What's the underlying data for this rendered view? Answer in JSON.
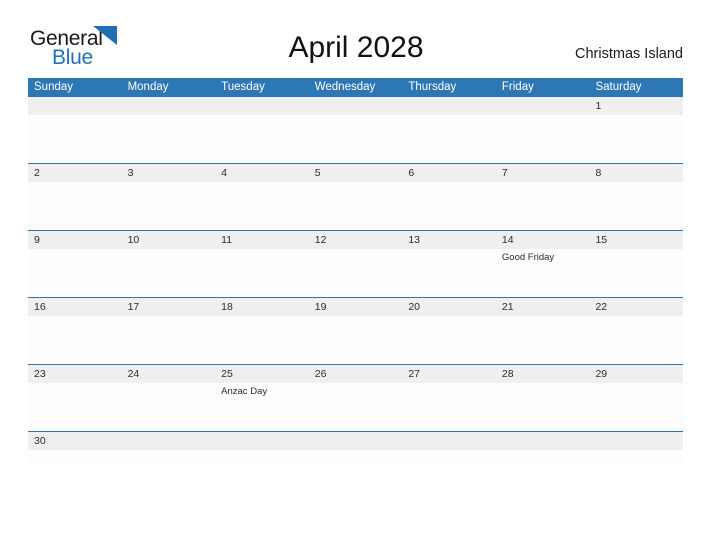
{
  "brand": {
    "name_part1": "General",
    "name_part2": "Blue",
    "flag_icon": "blue-flag-triangle",
    "color_dark": "#1A1A1A",
    "color_blue": "#2172B8"
  },
  "header": {
    "title": "April 2028",
    "location": "Christmas Island"
  },
  "theme": {
    "header_blue": "#2E77B5",
    "row_gray": "#EFEFEF",
    "body_white": "#FDFDFD",
    "text": "#2B2B2B"
  },
  "calendar": {
    "weekdays": [
      "Sunday",
      "Monday",
      "Tuesday",
      "Wednesday",
      "Thursday",
      "Friday",
      "Saturday"
    ],
    "weeks": [
      {
        "days": [
          {
            "num": "",
            "event": ""
          },
          {
            "num": "",
            "event": ""
          },
          {
            "num": "",
            "event": ""
          },
          {
            "num": "",
            "event": ""
          },
          {
            "num": "",
            "event": ""
          },
          {
            "num": "",
            "event": ""
          },
          {
            "num": "1",
            "event": ""
          }
        ]
      },
      {
        "days": [
          {
            "num": "2",
            "event": ""
          },
          {
            "num": "3",
            "event": ""
          },
          {
            "num": "4",
            "event": ""
          },
          {
            "num": "5",
            "event": ""
          },
          {
            "num": "6",
            "event": ""
          },
          {
            "num": "7",
            "event": ""
          },
          {
            "num": "8",
            "event": ""
          }
        ]
      },
      {
        "days": [
          {
            "num": "9",
            "event": ""
          },
          {
            "num": "10",
            "event": ""
          },
          {
            "num": "11",
            "event": ""
          },
          {
            "num": "12",
            "event": ""
          },
          {
            "num": "13",
            "event": ""
          },
          {
            "num": "14",
            "event": "Good Friday"
          },
          {
            "num": "15",
            "event": ""
          }
        ]
      },
      {
        "days": [
          {
            "num": "16",
            "event": ""
          },
          {
            "num": "17",
            "event": ""
          },
          {
            "num": "18",
            "event": ""
          },
          {
            "num": "19",
            "event": ""
          },
          {
            "num": "20",
            "event": ""
          },
          {
            "num": "21",
            "event": ""
          },
          {
            "num": "22",
            "event": ""
          }
        ]
      },
      {
        "days": [
          {
            "num": "23",
            "event": ""
          },
          {
            "num": "24",
            "event": ""
          },
          {
            "num": "25",
            "event": "Anzac Day"
          },
          {
            "num": "26",
            "event": ""
          },
          {
            "num": "27",
            "event": ""
          },
          {
            "num": "28",
            "event": ""
          },
          {
            "num": "29",
            "event": ""
          }
        ]
      },
      {
        "days": [
          {
            "num": "30",
            "event": ""
          },
          {
            "num": "",
            "event": ""
          },
          {
            "num": "",
            "event": ""
          },
          {
            "num": "",
            "event": ""
          },
          {
            "num": "",
            "event": ""
          },
          {
            "num": "",
            "event": ""
          },
          {
            "num": "",
            "event": ""
          }
        ]
      }
    ]
  }
}
